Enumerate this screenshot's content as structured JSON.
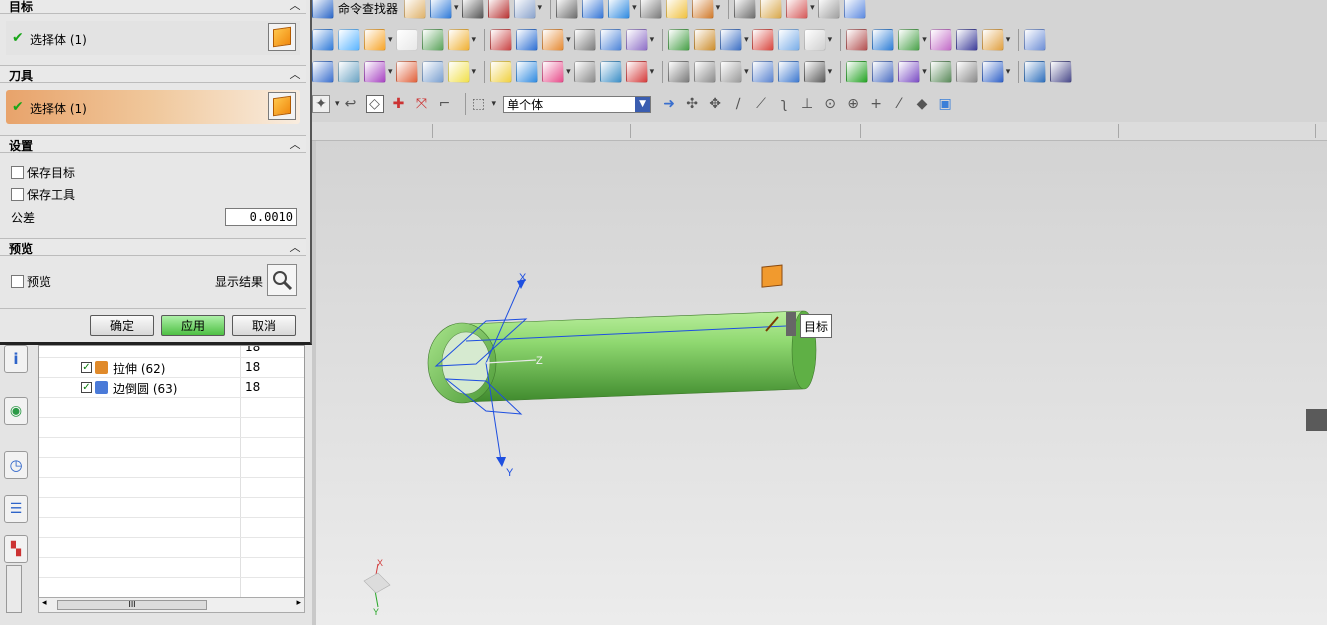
{
  "toolbar": {
    "command_finder_label": "命令查找器",
    "selection_filter_value": "单个体",
    "icon_colors": {
      "row1": [
        "#2a66c7",
        "#dfb26a",
        "#2f7ad8",
        "#555555",
        "#b83333",
        "#8aa3cc",
        "#6d6d6d",
        "#3475d6",
        "#2f8ae0",
        "#7a7a7a",
        "#f0c140",
        "#d0792a",
        "#6d6d6d",
        "#d8a84c",
        "#d55a5a",
        "#a0a0a0",
        "#5d8ae0"
      ],
      "row2": [
        "#2f7ad8",
        "#5bb5ff",
        "#f7a529",
        "#e8e8e8",
        "#5aa35a",
        "#f0b032",
        "#c94343",
        "#2d6fd3",
        "#e58a33",
        "#7d7d7d",
        "#4d84d8",
        "#8e6fc7",
        "#47a047",
        "#cc8d2c",
        "#3c6fc4",
        "#d8453d",
        "#7aaee8",
        "#d0d0d0",
        "#b35050",
        "#2d7dd6",
        "#4aa24a",
        "#c26bc7",
        "#3c3c9a",
        "#e0a040",
        "#6d8ed6"
      ],
      "row3": [
        "#3a6fce",
        "#6ca4c4",
        "#a743c2",
        "#e0603a",
        "#7aa0d0",
        "#f1e04a",
        "#f0d040",
        "#2f8ae0",
        "#e74c8a",
        "#8a8a8a",
        "#3b8ec6",
        "#d43b3b",
        "#7a7a7a",
        "#8c8c8c",
        "#9a9a9a",
        "#5b84d0",
        "#3d78cf",
        "#5b5b5b",
        "#24a324",
        "#4a6dc2",
        "#7a4cc4",
        "#5a8a5a",
        "#8a8a8a",
        "#2f60c7",
        "#2e6fbc",
        "#4a4a8a"
      ]
    }
  },
  "dialog": {
    "sections": {
      "target": "目标",
      "tool": "刀具",
      "settings": "设置",
      "preview": "预览"
    },
    "target_selection": "选择体 (1)",
    "tool_selection": "选择体 (1)",
    "keep_target_label": "保存目标",
    "keep_tool_label": "保存工具",
    "tolerance_label": "公差",
    "tolerance_value": "0.0010",
    "preview_label": "预览",
    "show_result_label": "显示结果",
    "ok_label": "确定",
    "apply_label": "应用",
    "cancel_label": "取消"
  },
  "tree": {
    "rows": [
      {
        "name": "拉伸 (62)",
        "value": "18",
        "icon_color": "#e08a2a"
      },
      {
        "name": "边倒圆 (63)",
        "value": "18",
        "icon_color": "#4a7ad8"
      }
    ],
    "partial_row_value": "18",
    "scroll_thumb_label": "III"
  },
  "viewport": {
    "tooltip_label": "目标",
    "axes": {
      "x": "X",
      "y": "Y",
      "z": "Z"
    },
    "triad": {
      "x": "X",
      "y": "Y"
    },
    "tube_color": "#7fcf60"
  }
}
